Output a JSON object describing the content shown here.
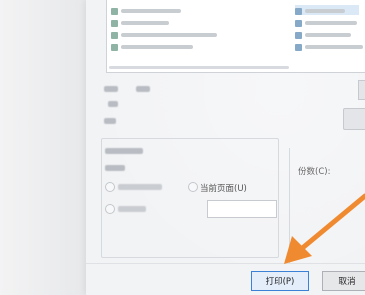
{
  "print_range": {
    "all_pages_label": "",
    "current_page_label": "当前页面(U)",
    "pages_label": "",
    "pages_input_value": ""
  },
  "copies": {
    "label": "份数(C):"
  },
  "footer": {
    "print_label": "打印(P)",
    "cancel_label": "取消"
  },
  "annotation": {
    "arrow_color": "#f08a30"
  },
  "colors": {
    "accent": "#3b82d6"
  }
}
